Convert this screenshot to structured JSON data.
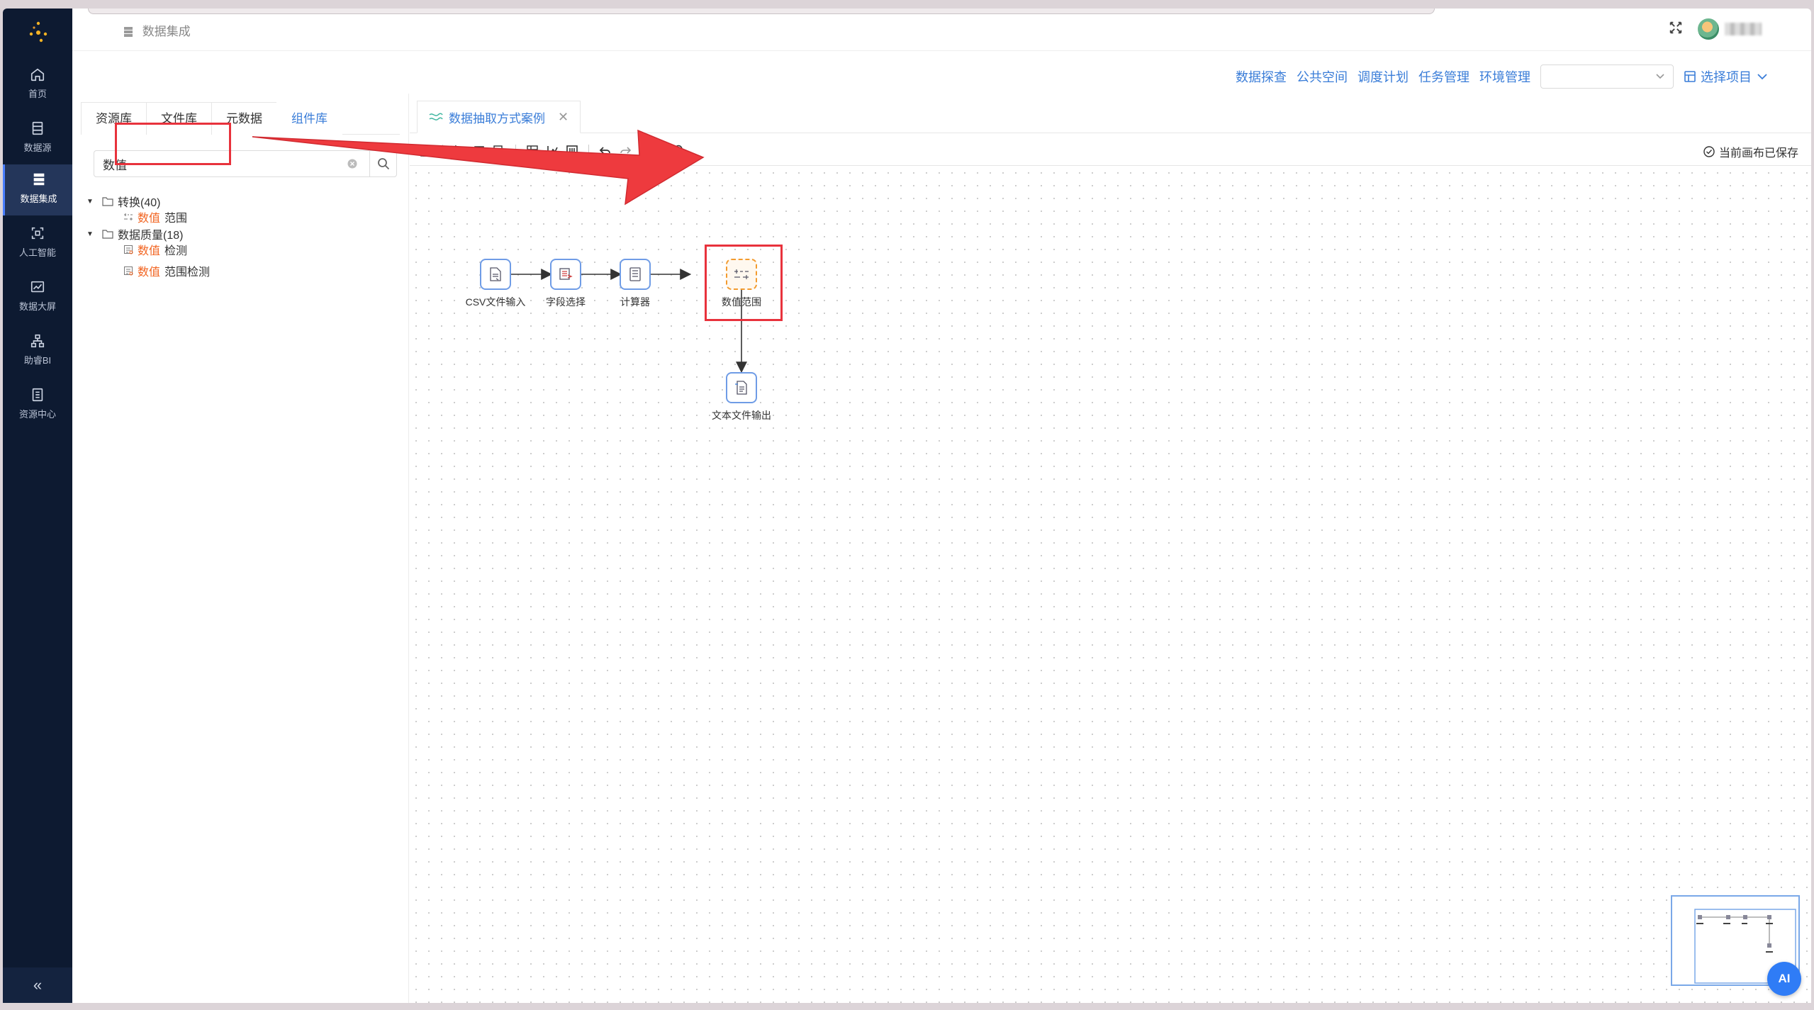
{
  "app": {
    "breadcrumb": "数据集成",
    "accent_color": "#3a7dd8",
    "highlight_color": "#f26522",
    "annotation_color": "#e8323c"
  },
  "sidenav": {
    "items": [
      {
        "label": "首页",
        "icon": "home-icon"
      },
      {
        "label": "数据源",
        "icon": "database-icon"
      },
      {
        "label": "数据集成",
        "icon": "integration-icon",
        "active": true
      },
      {
        "label": "人工智能",
        "icon": "ai-scan-icon"
      },
      {
        "label": "数据大屏",
        "icon": "chart-icon"
      },
      {
        "label": "助睿BI",
        "icon": "org-icon"
      },
      {
        "label": "资源中心",
        "icon": "book-icon"
      }
    ],
    "collapse": "«"
  },
  "topmenu": {
    "links": [
      "数据探查",
      "公共空间",
      "调度计划",
      "任务管理",
      "环境管理"
    ],
    "select_value": "",
    "pick_project": "选择项目"
  },
  "left_panel": {
    "tabs": [
      "资源库",
      "文件库",
      "元数据",
      "组件库"
    ],
    "active_tab": "组件库",
    "search_value": "数值",
    "tree": {
      "group1": {
        "label": "转换(40)",
        "children": [
          {
            "hl": "数值",
            "rest": " 范围"
          }
        ]
      },
      "group2": {
        "label": "数据质量(18)",
        "children": [
          {
            "hl": "数值",
            "rest": " 检测"
          },
          {
            "hl": "数值",
            "rest": " 范围检测"
          }
        ]
      }
    }
  },
  "workspace": {
    "tab_title": "数据抽取方式案例",
    "saved_status": "当前画布已保存",
    "nodes": [
      {
        "label": "CSV文件输入"
      },
      {
        "label": "字段选择"
      },
      {
        "label": "计算器"
      },
      {
        "label": "数值范围"
      },
      {
        "label": "文本文件输出"
      }
    ],
    "ai_button": "AI"
  }
}
